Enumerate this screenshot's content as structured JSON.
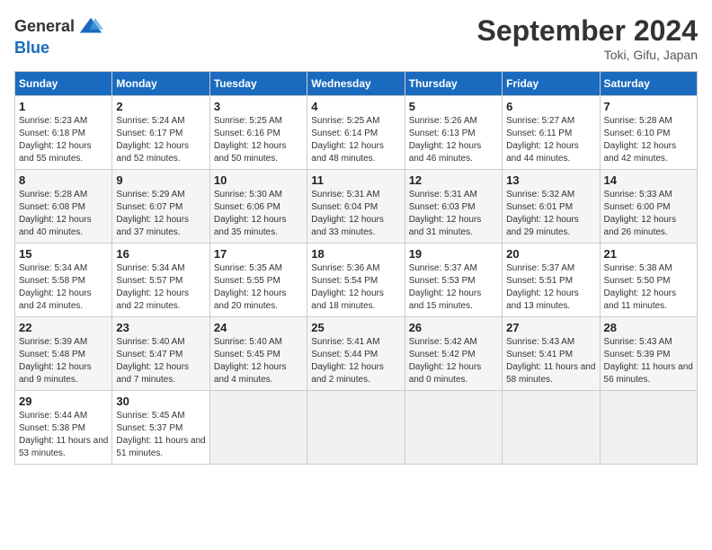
{
  "logo": {
    "general": "General",
    "blue": "Blue"
  },
  "title": "September 2024",
  "location": "Toki, Gifu, Japan",
  "days_of_week": [
    "Sunday",
    "Monday",
    "Tuesday",
    "Wednesday",
    "Thursday",
    "Friday",
    "Saturday"
  ],
  "weeks": [
    [
      {
        "day": "1",
        "sunrise": "5:23 AM",
        "sunset": "6:18 PM",
        "daylight": "12 hours and 55 minutes."
      },
      {
        "day": "2",
        "sunrise": "5:24 AM",
        "sunset": "6:17 PM",
        "daylight": "12 hours and 52 minutes."
      },
      {
        "day": "3",
        "sunrise": "5:25 AM",
        "sunset": "6:16 PM",
        "daylight": "12 hours and 50 minutes."
      },
      {
        "day": "4",
        "sunrise": "5:25 AM",
        "sunset": "6:14 PM",
        "daylight": "12 hours and 48 minutes."
      },
      {
        "day": "5",
        "sunrise": "5:26 AM",
        "sunset": "6:13 PM",
        "daylight": "12 hours and 46 minutes."
      },
      {
        "day": "6",
        "sunrise": "5:27 AM",
        "sunset": "6:11 PM",
        "daylight": "12 hours and 44 minutes."
      },
      {
        "day": "7",
        "sunrise": "5:28 AM",
        "sunset": "6:10 PM",
        "daylight": "12 hours and 42 minutes."
      }
    ],
    [
      {
        "day": "8",
        "sunrise": "5:28 AM",
        "sunset": "6:08 PM",
        "daylight": "12 hours and 40 minutes."
      },
      {
        "day": "9",
        "sunrise": "5:29 AM",
        "sunset": "6:07 PM",
        "daylight": "12 hours and 37 minutes."
      },
      {
        "day": "10",
        "sunrise": "5:30 AM",
        "sunset": "6:06 PM",
        "daylight": "12 hours and 35 minutes."
      },
      {
        "day": "11",
        "sunrise": "5:31 AM",
        "sunset": "6:04 PM",
        "daylight": "12 hours and 33 minutes."
      },
      {
        "day": "12",
        "sunrise": "5:31 AM",
        "sunset": "6:03 PM",
        "daylight": "12 hours and 31 minutes."
      },
      {
        "day": "13",
        "sunrise": "5:32 AM",
        "sunset": "6:01 PM",
        "daylight": "12 hours and 29 minutes."
      },
      {
        "day": "14",
        "sunrise": "5:33 AM",
        "sunset": "6:00 PM",
        "daylight": "12 hours and 26 minutes."
      }
    ],
    [
      {
        "day": "15",
        "sunrise": "5:34 AM",
        "sunset": "5:58 PM",
        "daylight": "12 hours and 24 minutes."
      },
      {
        "day": "16",
        "sunrise": "5:34 AM",
        "sunset": "5:57 PM",
        "daylight": "12 hours and 22 minutes."
      },
      {
        "day": "17",
        "sunrise": "5:35 AM",
        "sunset": "5:55 PM",
        "daylight": "12 hours and 20 minutes."
      },
      {
        "day": "18",
        "sunrise": "5:36 AM",
        "sunset": "5:54 PM",
        "daylight": "12 hours and 18 minutes."
      },
      {
        "day": "19",
        "sunrise": "5:37 AM",
        "sunset": "5:53 PM",
        "daylight": "12 hours and 15 minutes."
      },
      {
        "day": "20",
        "sunrise": "5:37 AM",
        "sunset": "5:51 PM",
        "daylight": "12 hours and 13 minutes."
      },
      {
        "day": "21",
        "sunrise": "5:38 AM",
        "sunset": "5:50 PM",
        "daylight": "12 hours and 11 minutes."
      }
    ],
    [
      {
        "day": "22",
        "sunrise": "5:39 AM",
        "sunset": "5:48 PM",
        "daylight": "12 hours and 9 minutes."
      },
      {
        "day": "23",
        "sunrise": "5:40 AM",
        "sunset": "5:47 PM",
        "daylight": "12 hours and 7 minutes."
      },
      {
        "day": "24",
        "sunrise": "5:40 AM",
        "sunset": "5:45 PM",
        "daylight": "12 hours and 4 minutes."
      },
      {
        "day": "25",
        "sunrise": "5:41 AM",
        "sunset": "5:44 PM",
        "daylight": "12 hours and 2 minutes."
      },
      {
        "day": "26",
        "sunrise": "5:42 AM",
        "sunset": "5:42 PM",
        "daylight": "12 hours and 0 minutes."
      },
      {
        "day": "27",
        "sunrise": "5:43 AM",
        "sunset": "5:41 PM",
        "daylight": "11 hours and 58 minutes."
      },
      {
        "day": "28",
        "sunrise": "5:43 AM",
        "sunset": "5:39 PM",
        "daylight": "11 hours and 56 minutes."
      }
    ],
    [
      {
        "day": "29",
        "sunrise": "5:44 AM",
        "sunset": "5:38 PM",
        "daylight": "11 hours and 53 minutes."
      },
      {
        "day": "30",
        "sunrise": "5:45 AM",
        "sunset": "5:37 PM",
        "daylight": "11 hours and 51 minutes."
      },
      null,
      null,
      null,
      null,
      null
    ]
  ]
}
